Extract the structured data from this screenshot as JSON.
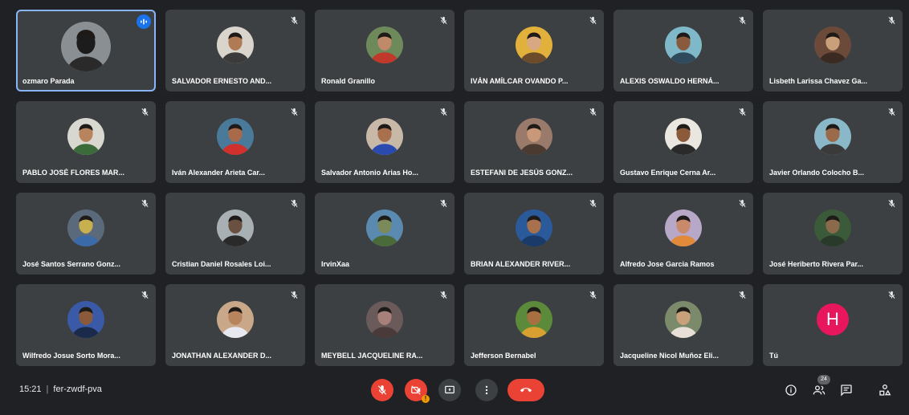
{
  "meeting": {
    "time": "15:21",
    "code": "fer-zwdf-pva",
    "participant_count": "24"
  },
  "participants": [
    {
      "name": "ozmaro Parada",
      "active_speaker": true,
      "avatar": "photo",
      "bg": "#8a8f94",
      "skin": "#1c1c1c",
      "shirt": "#2a2a2a"
    },
    {
      "name": "SALVADOR ERNESTO AND...",
      "avatar": "photo",
      "bg": "#d9d4cc",
      "skin": "#b07a55",
      "shirt": "#3b3b3b"
    },
    {
      "name": "Ronald Granillo",
      "avatar": "photo",
      "bg": "#6f8a5a",
      "skin": "#c08a6a",
      "shirt": "#c0392b"
    },
    {
      "name": "IVÁN AMÍLCAR OVANDO P...",
      "avatar": "photo",
      "bg": "#e2b13c",
      "skin": "#d8a882",
      "shirt": "#6b4b2a"
    },
    {
      "name": "ALEXIS OSWALDO HERNÁ...",
      "avatar": "photo",
      "bg": "#7fb8c9",
      "skin": "#8a5a3c",
      "shirt": "#2e4a5c"
    },
    {
      "name": "Lisbeth Larissa Chavez Ga...",
      "avatar": "photo",
      "bg": "#6b4a3a",
      "skin": "#caa07a",
      "shirt": "#3a2a22"
    },
    {
      "name": "PABLO JOSÉ FLORES MAR...",
      "avatar": "photo",
      "bg": "#d8d8d0",
      "skin": "#b8845e",
      "shirt": "#3b6b3b"
    },
    {
      "name": "Iván Alexander Arieta Car...",
      "avatar": "photo",
      "bg": "#4a7a9a",
      "skin": "#a86a4a",
      "shirt": "#d0312d"
    },
    {
      "name": "Salvador Antonio Arias Ho...",
      "avatar": "photo",
      "bg": "#c8b8a8",
      "skin": "#a8704c",
      "shirt": "#2a4ab0"
    },
    {
      "name": "ESTEFANI DE JESÚS GONZ...",
      "avatar": "photo",
      "bg": "#9a7a6a",
      "skin": "#c89878",
      "shirt": "#4a3a30"
    },
    {
      "name": "Gustavo Enrique Cerna Ar...",
      "avatar": "photo",
      "bg": "#eae6e0",
      "skin": "#8a5a3a",
      "shirt": "#2a2a2a"
    },
    {
      "name": "Javier Orlando Colocho B...",
      "avatar": "photo",
      "bg": "#8ab8c8",
      "skin": "#9a6a4a",
      "shirt": "#3a3a3a"
    },
    {
      "name": "José Santos Serrano Gonz...",
      "avatar": "photo",
      "bg": "#5a6a7a",
      "skin": "#c8b050",
      "shirt": "#3a6aa8"
    },
    {
      "name": "Cristian Daniel Rosales Loi...",
      "avatar": "photo",
      "bg": "#a8b0b4",
      "skin": "#6a5040",
      "shirt": "#2a2a2a"
    },
    {
      "name": "IrvinXaa",
      "avatar": "photo",
      "bg": "#5a8ab0",
      "skin": "#7a8a5a",
      "shirt": "#4a6a3a"
    },
    {
      "name": "BRIAN ALEXANDER RIVER...",
      "avatar": "photo",
      "bg": "#2a5a9a",
      "skin": "#a8704c",
      "shirt": "#1a3a6a"
    },
    {
      "name": "Alfredo Jose Garcia Ramos",
      "avatar": "photo",
      "bg": "#b8a8c8",
      "skin": "#c88a6a",
      "shirt": "#e08a3a"
    },
    {
      "name": "José Heriberto Rivera Par...",
      "avatar": "photo",
      "bg": "#3a5a3a",
      "skin": "#8a6a4a",
      "shirt": "#2a3a2a"
    },
    {
      "name": "Wilfredo Josue Sorto Mora...",
      "avatar": "photo",
      "bg": "#3a5aa8",
      "skin": "#8a5a3a",
      "shirt": "#1a2a4a"
    },
    {
      "name": "JONATHAN ALEXANDER D...",
      "avatar": "photo",
      "bg": "#c8a888",
      "skin": "#b8845e",
      "shirt": "#e8e8f0"
    },
    {
      "name": "MEYBELL JACQUELINE RA...",
      "avatar": "photo",
      "bg": "#6a5a5a",
      "skin": "#a8807a",
      "shirt": "#4a3a3a"
    },
    {
      "name": "Jefferson Bernabel",
      "avatar": "photo",
      "bg": "#5a8a3a",
      "skin": "#a87040",
      "shirt": "#d8a030"
    },
    {
      "name": "Jacqueline Nicol Muñoz Eli...",
      "avatar": "photo",
      "bg": "#7a8a6a",
      "skin": "#c8a07a",
      "shirt": "#e8e0d8"
    },
    {
      "name": "Tú",
      "avatar": "letter",
      "letter": "H",
      "letter_bg": "#e8175d"
    }
  ],
  "colors": {
    "background": "#202124",
    "tile": "#3c4043",
    "active_outline": "#8ab4f8",
    "danger": "#ea4335",
    "speaking": "#1a73e8"
  },
  "controls": {
    "mic": "mic-off-icon",
    "camera": "camera-off-icon",
    "present": "present-screen-icon",
    "more": "more-vert-icon",
    "leave": "call-end-icon"
  },
  "side_panel_icons": [
    "info-icon",
    "people-icon",
    "chat-icon",
    "activities-icon"
  ]
}
